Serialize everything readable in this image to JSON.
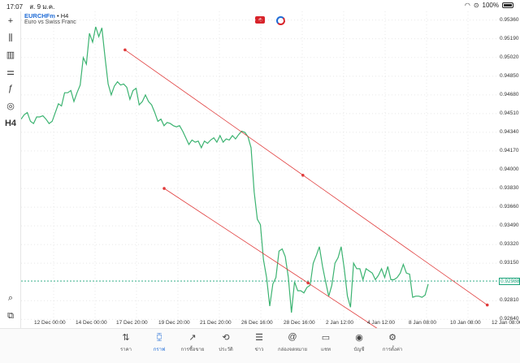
{
  "status_bar": {
    "time": "17:07",
    "date": "ส. 9 ม.ค.",
    "battery": "100%"
  },
  "symbol": {
    "name": "EURCHFm",
    "timeframe": "H4",
    "description": "Euro vs Swiss Franc",
    "separator": "•"
  },
  "toolbar": [
    {
      "name": "crosshair-tool-icon",
      "glyph": "+"
    },
    {
      "name": "chart-type-icon",
      "glyph": "⫼"
    },
    {
      "name": "indicators-icon",
      "glyph": "▥"
    },
    {
      "name": "objects-icon",
      "glyph": "⚌"
    },
    {
      "name": "function-icon",
      "glyph": "ƒ"
    },
    {
      "name": "shapes-icon",
      "glyph": "◎"
    },
    {
      "name": "timeframe-button",
      "glyph": "H4"
    }
  ],
  "price_labels": [
    "0.95360",
    "0.95190",
    "0.95020",
    "0.94850",
    "0.94680",
    "0.94510",
    "0.94340",
    "0.94170",
    "0.94000",
    "0.93830",
    "0.93660",
    "0.93490",
    "0.93320",
    "0.93150",
    "0.92810",
    "0.92640"
  ],
  "current_price": "0.92988",
  "time_labels": [
    "12 Dec 00:00",
    "14 Dec 00:00",
    "17 Dec 20:00",
    "19 Dec 20:00",
    "21 Dec 20:00",
    "26 Dec 16:00",
    "28 Dec 16:00",
    "2 Jan 12:00",
    "4 Jan 12:00",
    "8 Jan 08:00",
    "10 Jan 08:00",
    "12 Jan 08:00"
  ],
  "chart_data": {
    "type": "line",
    "title": "",
    "ylim": [
      0.9256,
      0.9544
    ],
    "y": [
      0.9446,
      0.945,
      0.9452,
      0.9444,
      0.9442,
      0.9448,
      0.9448,
      0.9449,
      0.9446,
      0.9442,
      0.9444,
      0.9452,
      0.946,
      0.9458,
      0.947,
      0.947,
      0.9472,
      0.9462,
      0.947,
      0.9477,
      0.9502,
      0.9496,
      0.9524,
      0.9516,
      0.953,
      0.9521,
      0.9529,
      0.9502,
      0.9478,
      0.9468,
      0.9476,
      0.948,
      0.9477,
      0.9478,
      0.9475,
      0.9464,
      0.9472,
      0.9474,
      0.9459,
      0.9462,
      0.9468,
      0.9462,
      0.9459,
      0.9452,
      0.9444,
      0.9446,
      0.944,
      0.9443,
      0.9442,
      0.944,
      0.9439,
      0.944,
      0.9435,
      0.9429,
      0.9423,
      0.9427,
      0.9425,
      0.9426,
      0.942,
      0.9426,
      0.9424,
      0.9427,
      0.9429,
      0.9425,
      0.9431,
      0.9425,
      0.9428,
      0.9427,
      0.9431,
      0.9428,
      0.9432,
      0.9435,
      0.9434,
      0.943,
      0.942,
      0.938,
      0.9355,
      0.935,
      0.9318,
      0.9302,
      0.9276,
      0.9296,
      0.9302,
      0.9326,
      0.9328,
      0.9321,
      0.9302,
      0.927,
      0.9298,
      0.929,
      0.929,
      0.9288,
      0.9293,
      0.9295,
      0.9315,
      0.9322,
      0.933,
      0.9312,
      0.9298,
      0.9285,
      0.9295,
      0.9315,
      0.932,
      0.933,
      0.931,
      0.9285,
      0.9275,
      0.9315,
      0.931,
      0.931,
      0.93,
      0.931,
      0.9308,
      0.9306,
      0.93,
      0.9304,
      0.931,
      0.9302,
      0.9312,
      0.93,
      0.93,
      0.9302,
      0.9306,
      0.9314,
      0.9306,
      0.9305,
      0.9284,
      0.9285,
      0.9285,
      0.9284,
      0.9286,
      0.9296
    ],
    "line_color": "#3cb371",
    "current_price": 0.92988,
    "trendlines": [
      {
        "name": "upper",
        "color": "#e03a3a",
        "points": [
          [
            0.2175,
            0.9509
          ],
          [
            0.5898,
            0.9395
          ],
          [
            0.9757,
            0.9277
          ]
        ]
      },
      {
        "name": "lower",
        "color": "#e03a3a",
        "points": [
          [
            0.2994,
            0.9383
          ],
          [
            0.6006,
            0.9297
          ],
          [
            0.8038,
            0.9239
          ]
        ]
      }
    ]
  },
  "tabs": [
    {
      "name": "tab-quotes",
      "icon": "⇅",
      "label": "ราคา",
      "active": false
    },
    {
      "name": "tab-charts",
      "icon": "⧮",
      "label": "กราฟ",
      "active": true
    },
    {
      "name": "tab-trade",
      "icon": "↗",
      "label": "การซื้อขาย",
      "active": false
    },
    {
      "name": "tab-history",
      "icon": "⟲",
      "label": "ประวัติ",
      "active": false
    },
    {
      "name": "tab-news",
      "icon": "☰",
      "label": "ข่าว",
      "active": false
    },
    {
      "name": "tab-mailbox",
      "icon": "@",
      "label": "กล่องจดหมาย",
      "active": false
    },
    {
      "name": "tab-chat",
      "icon": "▭",
      "label": "แชท",
      "active": false
    },
    {
      "name": "tab-accounts",
      "icon": "◉",
      "label": "บัญชี",
      "active": false
    },
    {
      "name": "tab-settings",
      "icon": "⚙",
      "label": "การตั้งค่า",
      "active": false
    }
  ]
}
